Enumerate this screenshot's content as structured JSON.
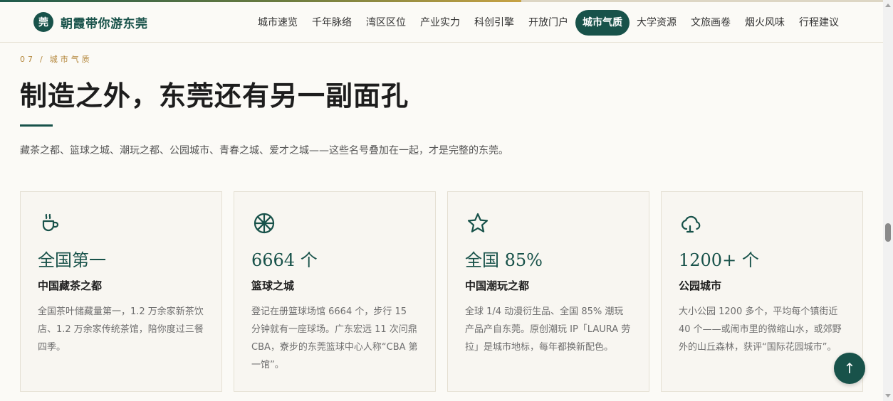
{
  "progress": {
    "value": 0.59
  },
  "brand": {
    "logo_text": "莞",
    "name": "朝霞带你游东莞"
  },
  "nav": {
    "items": [
      {
        "label": "城市速览",
        "active": false
      },
      {
        "label": "千年脉络",
        "active": false
      },
      {
        "label": "湾区区位",
        "active": false
      },
      {
        "label": "产业实力",
        "active": false
      },
      {
        "label": "科创引擎",
        "active": false
      },
      {
        "label": "开放门户",
        "active": false
      },
      {
        "label": "城市气质",
        "active": true
      },
      {
        "label": "大学资源",
        "active": false
      },
      {
        "label": "文旅画卷",
        "active": false
      },
      {
        "label": "烟火风味",
        "active": false
      },
      {
        "label": "行程建议",
        "active": false
      }
    ]
  },
  "section": {
    "number": "07",
    "separator": "/",
    "name": "城市气质",
    "title": "制造之外，东莞还有另一副面孔",
    "subtitle": "藏茶之都、篮球之城、潮玩之都、公园城市、青春之城、爱才之城——这些名号叠加在一起，才是完整的东莞。"
  },
  "cards": [
    {
      "icon": "teacup-icon",
      "stat": "全国第一",
      "title": "中国藏茶之都",
      "desc": "全国茶叶储藏量第一，1.2 万余家新茶饮店、1.2 万余家传统茶馆，陪你度过三餐四季。"
    },
    {
      "icon": "basketball-icon",
      "stat": "6664 个",
      "title": "篮球之城",
      "desc": "登记在册篮球场馆 6664 个，步行 15 分钟就有一座球场。广东宏远 11 次问鼎 CBA，寮步的东莞篮球中心人称“CBA 第一馆”。"
    },
    {
      "icon": "star-icon",
      "stat": "全国 85%",
      "title": "中国潮玩之都",
      "desc": "全球 1/4 动漫衍生品、全国 85% 潮玩产品产自东莞。原创潮玩 IP「LAURA 劳拉」是城市地标，每年都换新配色。"
    },
    {
      "icon": "cloud-icon",
      "stat": "1200+ 个",
      "title": "公园城市",
      "desc": "大小公园 1200 多个，平均每个镇街近 40 个——或闹市里的微缩山水，或郊野外的山丘森林，获评“国际花园城市”。"
    }
  ],
  "back_to_top": {
    "label": "↑"
  },
  "colors": {
    "accent": "#18524a",
    "gold": "#b4873c",
    "background": "#fbfaf6"
  }
}
